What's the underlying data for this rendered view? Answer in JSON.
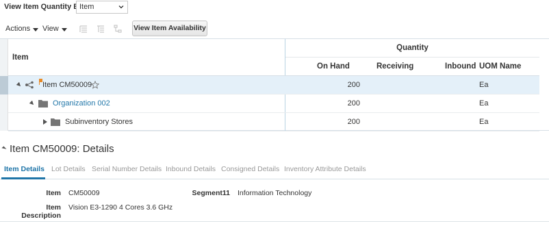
{
  "view_quantity": {
    "label": "View Item Quantity By",
    "selected": "Item"
  },
  "toolbar": {
    "actions_label": "Actions",
    "view_label": "View",
    "view_availability_label": "View Item Availability"
  },
  "grid": {
    "item_header": "Item",
    "quantity_group_header": "Quantity",
    "columns": [
      "On Hand",
      "Receiving",
      "Inbound",
      "UOM Name"
    ],
    "rows": [
      {
        "name": "Item CM50009",
        "on_hand": "200",
        "receiving": "",
        "inbound": "",
        "uom": "Ea"
      },
      {
        "name": "Organization 002",
        "on_hand": "200",
        "receiving": "",
        "inbound": "",
        "uom": "Ea"
      },
      {
        "name": "Subinventory Stores",
        "on_hand": "200",
        "receiving": "",
        "inbound": "",
        "uom": "Ea"
      }
    ]
  },
  "details": {
    "title": "Item CM50009: Details",
    "tabs": [
      "Item Details",
      "Lot Details",
      "Serial Number Details",
      "Inbound Details",
      "Consigned Details",
      "Inventory Attribute Details"
    ],
    "fields": {
      "item_label": "Item",
      "item_value": "CM50009",
      "segment_label": "Segment11",
      "segment_value": "Information Technology",
      "desc_label": "Item Description",
      "desc_value": "Vision E3-1290 4 Cores 3.6 GHz"
    }
  },
  "colors": {
    "link": "#1f75a8",
    "selected_row": "#e4f0f9",
    "divider": "#b9d3e3"
  }
}
